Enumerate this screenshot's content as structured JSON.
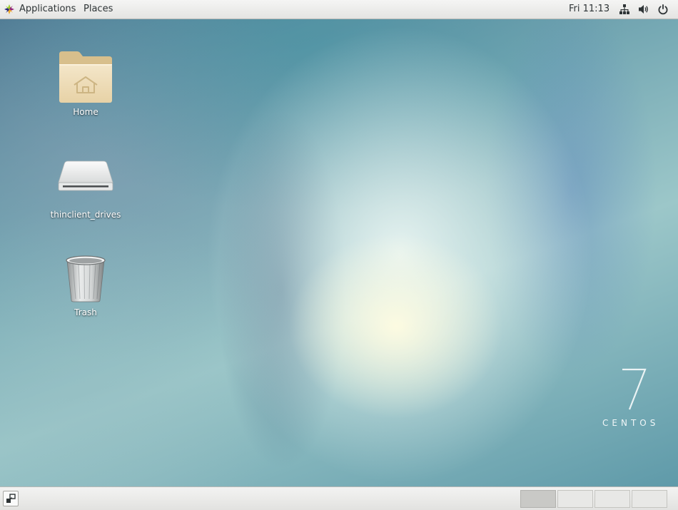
{
  "top_panel": {
    "applications_label": "Applications",
    "places_label": "Places",
    "clock": "Fri 11:13",
    "tray_icons": [
      "network-icon",
      "volume-icon",
      "power-icon"
    ]
  },
  "desktop": {
    "icons": [
      {
        "label": "Home",
        "icon": "home-folder-icon"
      },
      {
        "label": "thinclient_drives",
        "icon": "drive-icon"
      },
      {
        "label": "Trash",
        "icon": "trash-icon"
      }
    ],
    "watermark": {
      "number": "7",
      "word": "CENTOS"
    }
  },
  "bottom_panel": {
    "show_desktop_icon": "show-desktop-icon",
    "workspaces": [
      {
        "active": true
      },
      {
        "active": false
      },
      {
        "active": false
      },
      {
        "active": false
      }
    ]
  },
  "colors": {
    "panel": "#ecebea",
    "wallpaper_base": "#76a9b4",
    "label_text": "#ffffff"
  }
}
